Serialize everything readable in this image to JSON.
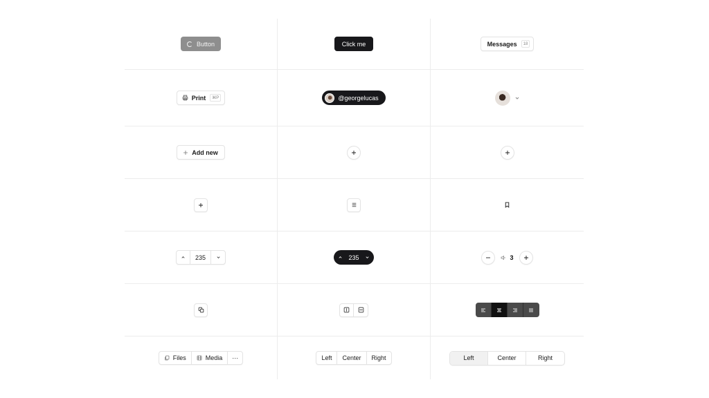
{
  "row1": {
    "loading_button": {
      "label": "Button",
      "icon": "spinner-icon"
    },
    "primary_button": {
      "label": "Click me"
    },
    "messages_button": {
      "label": "Messages",
      "badge": "18"
    }
  },
  "row2": {
    "print_button": {
      "label": "Print",
      "shortcut": "⌘P",
      "icon": "printer-icon"
    },
    "user_chip": {
      "label": "@georgelucas",
      "icon": "avatar"
    },
    "avatar_menu": {
      "icon": "chevron-down-icon"
    }
  },
  "row3": {
    "add_new_button": {
      "label": "Add new",
      "icon": "plus-icon"
    },
    "add_round_outline": {
      "icon": "plus-icon"
    },
    "add_round_outline_2": {
      "icon": "plus-icon"
    }
  },
  "row4": {
    "add_square": {
      "icon": "plus-icon"
    },
    "menu_square": {
      "icon": "menu-icon"
    },
    "bookmark_ghost": {
      "icon": "bookmark-icon"
    }
  },
  "row5": {
    "stepper": {
      "value": "235"
    },
    "stepper_dark": {
      "value": "235"
    },
    "volume_counter": {
      "value": "3",
      "icon": "volume-icon"
    }
  },
  "row6": {
    "copy_button": {
      "icon": "copy-icon"
    },
    "split_group": {
      "icons": [
        "split-horizontal-icon",
        "split-vertical-icon"
      ]
    },
    "align_group": {
      "icons": [
        "align-left-icon",
        "align-center-icon",
        "align-right-icon",
        "align-justify-icon"
      ],
      "active_index": 1
    }
  },
  "row7": {
    "files_group": {
      "files": "Files",
      "media": "Media",
      "more": "···"
    },
    "segmented_small": [
      "Left",
      "Center",
      "Right"
    ],
    "segmented_wide": {
      "items": [
        "Left",
        "Center",
        "Right"
      ],
      "active_index": 0
    }
  },
  "colors": {
    "dark": "#18181b",
    "border": "#e3e3e3",
    "loading": "#8e8e8e",
    "grid": "#ececec"
  }
}
